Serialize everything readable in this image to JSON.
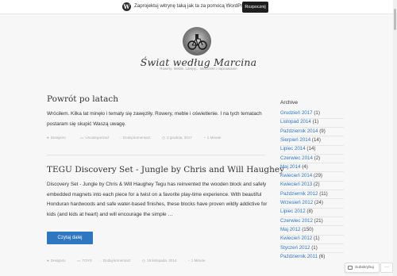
{
  "wp_bar": {
    "logo_glyph": "W",
    "message": "Zaprojektuj witrynę taką jak ta za pomocą WordPress.com",
    "cta_label": "Rozpocznij"
  },
  "site": {
    "title": "Świat według Marcina",
    "description": "Rowery. Meble. Lampy... tworzenie i naprawianie"
  },
  "posts": [
    {
      "title": "Powrót po latach",
      "body": "Wróciłem. Kilka lat minęło i tematy się zawęziły. Rowery, meble i oświetlenie. I na tych tematach postaram się skupić Waszą uwagę.",
      "meta": {
        "author": "Design4c",
        "category": "Uncategorized",
        "comments": "Dodaj komentarz",
        "date": "3 grudnia, 2017",
        "read_time": "1 Minute"
      }
    },
    {
      "title": "TEGU Discovery Set - Jungle by Chris and Will Haughey",
      "body": "Discovery Set - Jungle by Chris & Will Haughey Tegu has reinvented the wooden block and safely embedded magnets into each piece for a twist on a favorite play-time experience. With beautiful Honduran hardwoods and safe water-based finishes, these blocks have proven wildly addictive for kids (and kids at heart) and will encourage the simple …",
      "read_more": "Czytaj dalej",
      "meta": {
        "author": "Design4c",
        "category": "TOYS",
        "comments": "Dodaj komentarz",
        "date": "16 listopada, 2014",
        "read_time": "1 Minute"
      }
    }
  ],
  "sidebar": {
    "heading": "Archive",
    "archive": [
      {
        "month": "Grudzień 2017",
        "count": "(1)"
      },
      {
        "month": "Listopad 2014",
        "count": "(1)"
      },
      {
        "month": "Październik 2014",
        "count": "(9)"
      },
      {
        "month": "Sierpień 2014",
        "count": "(14)"
      },
      {
        "month": "Lipiec 2014",
        "count": "(14)"
      },
      {
        "month": "Czerwiec 2014",
        "count": "(2)"
      },
      {
        "month": "Maj 2014",
        "count": "(4)"
      },
      {
        "month": "Kwiecień 2014",
        "count": "(29)"
      },
      {
        "month": "Kwiecień 2013",
        "count": "(2)"
      },
      {
        "month": "Październik 2012",
        "count": "(11)"
      },
      {
        "month": "Wrzesień 2012",
        "count": "(24)"
      },
      {
        "month": "Lipiec 2012",
        "count": "(8)"
      },
      {
        "month": "Czerwiec 2012",
        "count": "(21)"
      },
      {
        "month": "Maj 2012",
        "count": "(150)"
      },
      {
        "month": "Kwiecień 2012",
        "count": "(1)"
      },
      {
        "month": "Styczeń 2012",
        "count": "(1)"
      },
      {
        "month": "Październik 2011",
        "count": "(6)"
      }
    ]
  },
  "follow": {
    "label": "Subskrybuj",
    "more": "···"
  },
  "colors": {
    "accent": "#2e76c0",
    "background": "#f7f7f7",
    "text": "#333333"
  }
}
